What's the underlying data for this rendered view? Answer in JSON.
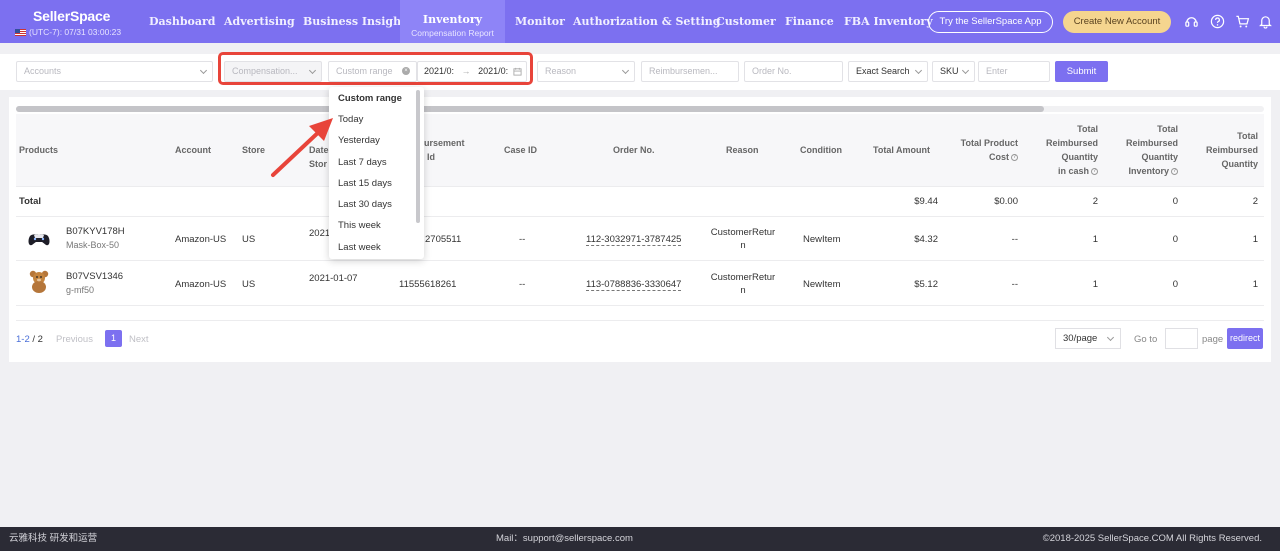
{
  "header": {
    "brand": "SellerSpace",
    "timezone": "(UTC-7): 07/31 03:00:23",
    "nav": [
      "Dashboard",
      "Advertising",
      "Business Insight",
      "Monitor",
      "Authorization & Setting",
      "Customer",
      "Finance",
      "FBA Inventory"
    ],
    "active_nav": {
      "label": "Inventory",
      "sub": "Compensation Report"
    },
    "try_app": "Try the SellerSpace App",
    "create_account": "Create New Account"
  },
  "filters": {
    "accounts_placeholder": "Accounts",
    "compensation_placeholder": "Compensation...",
    "range_label": "Custom range",
    "date_start": "2021/0:",
    "date_arrow": "→",
    "date_end": "2021/0:",
    "reason_placeholder": "Reason",
    "reimbursement_placeholder": "Reimbursemen...",
    "order_placeholder": "Order No.",
    "search_mode": "Exact Search",
    "search_field": "SKU",
    "search_placeholder": "Enter",
    "submit": "Submit"
  },
  "dropdown": {
    "items": [
      "Custom range",
      "Today",
      "Yesterday",
      "Last 7 days",
      "Last 15 days",
      "Last 30 days",
      "This week",
      "Last week"
    ],
    "selected": "Custom range"
  },
  "table": {
    "headers": {
      "products": "Products",
      "account": "Account",
      "store": "Store",
      "date_1": "Date",
      "date_2": "Stor",
      "reimb_1": "ursement",
      "reimb_2": "Id",
      "case_id": "Case ID",
      "order_no": "Order No.",
      "reason": "Reason",
      "condition": "Condition",
      "total_amount": "Total Amount",
      "cost_1": "Total Product",
      "cost_2": "Cost",
      "cash_1": "Total",
      "cash_2": "Reimbursed",
      "cash_3": "Quantity",
      "cash_4": "in cash",
      "inv_1": "Total",
      "inv_2": "Reimbursed",
      "inv_3": "Quantity",
      "inv_4": "Inventory",
      "qty_1": "Total",
      "qty_2": "Reimbursed",
      "qty_3": "Quantity"
    },
    "total_row": {
      "label": "Total",
      "amount": "$9.44",
      "cost": "$0.00",
      "cash": "2",
      "inventory": "0",
      "quantity": "2"
    },
    "rows": [
      {
        "asin": "B07KYV178H",
        "sku": "Mask-Box-50",
        "account": "Amazon-US",
        "store": "US",
        "date": "2021",
        "reimb_id": "2705511",
        "case_id": "--",
        "order": "112-3032971-3787425",
        "reason_1": "CustomerRetur",
        "reason_2": "n",
        "condition": "NewItem",
        "amount": "$4.32",
        "cost": "--",
        "cash": "1",
        "inventory": "0",
        "quantity": "1"
      },
      {
        "asin": "B07VSV1346",
        "sku": "g-mf50",
        "account": "Amazon-US",
        "store": "US",
        "date": "2021-01-07",
        "reimb_id": "11555618261",
        "case_id": "--",
        "order": "113-0788836-3330647",
        "reason_1": "CustomerRetur",
        "reason_2": "n",
        "condition": "NewItem",
        "amount": "$5.12",
        "cost": "--",
        "cash": "1",
        "inventory": "0",
        "quantity": "1"
      }
    ]
  },
  "pagination": {
    "range": "1-2",
    "separator": " / ",
    "total": "2",
    "previous": "Previous",
    "current": "1",
    "next": "Next",
    "page_size": "30/page",
    "goto": "Go to",
    "page": "page",
    "redirect": "redirect"
  },
  "footer": {
    "left": "云雅科技 研发和运营",
    "mail": "Mail：support@sellerspace.com",
    "copyright": "©2018-2025 SellerSpace.COM All Rights Reserved."
  },
  "colors": {
    "primary": "#7c70f0",
    "highlight_box": "#e8443a",
    "create_btn": "#f5d58f",
    "footer": "#2b2b35"
  }
}
